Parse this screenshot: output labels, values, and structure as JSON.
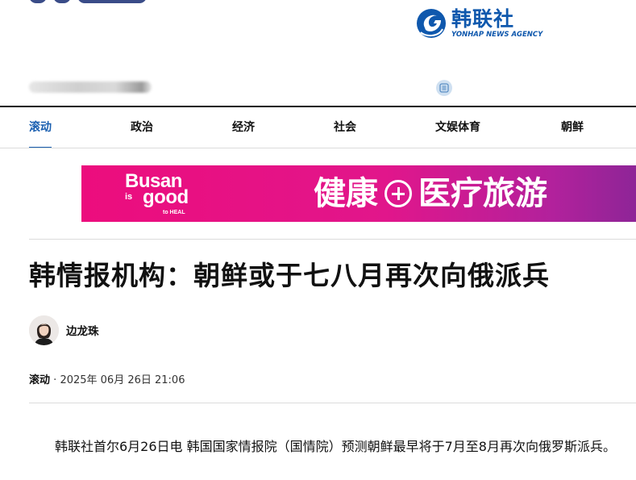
{
  "brand": {
    "name_cn": "韩联社",
    "name_en": "YONHAP NEWS AGENCY"
  },
  "nav": {
    "items": [
      {
        "label": "滚动",
        "active": true
      },
      {
        "label": "政治",
        "active": false
      },
      {
        "label": "经济",
        "active": false
      },
      {
        "label": "社会",
        "active": false
      },
      {
        "label": "文娱体育",
        "active": false
      },
      {
        "label": "朝鲜",
        "active": false
      }
    ]
  },
  "banner": {
    "brand_line1": "Busan",
    "brand_is": "is",
    "brand_good": "good",
    "brand_heal": "to HEAL",
    "slogan_left": "健康",
    "slogan_right": "医疗旅游",
    "bg_color": "#e5117f"
  },
  "article": {
    "headline": "韩情报机构：朝鲜或于七八月再次向俄派兵",
    "author": "边龙珠",
    "category": "滚动",
    "separator": "·",
    "timestamp": "2025年 06月 26日 21:06",
    "body": "韩联社首尔6月26日电 韩国国家情报院（国情院）预测朝鲜最早将于7月至8月再次向俄罗斯派兵。"
  },
  "colors": {
    "accent": "#1a5fb0",
    "brand_blue": "#0f58ad"
  },
  "icons": {
    "news_icon": "document-lines-icon"
  }
}
